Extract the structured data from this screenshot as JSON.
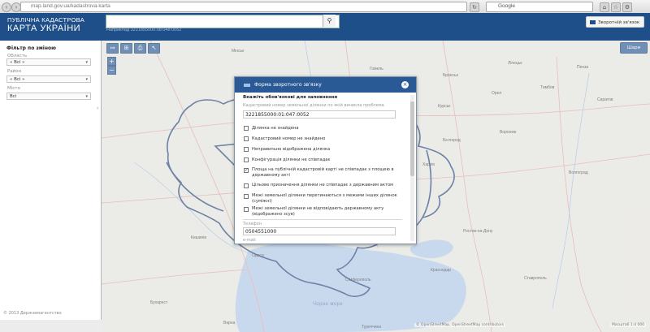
{
  "browser": {
    "url": "map.land.gov.ua/kadastrova-karta",
    "search_text": "Google"
  },
  "header": {
    "brand_line1": "ПУБЛІЧНА КАДАСТРОВА",
    "brand_line2": "КАРТА УКРАЇНИ",
    "search_value": "",
    "search_hint": "Наприклад 3221855000:08:048:0052",
    "feedback_label": "Зворотній зв'язок"
  },
  "sidebar": {
    "title": "Фільтр по зміною",
    "fields": [
      {
        "label": "Область",
        "value": "« Всі »"
      },
      {
        "label": "Район",
        "value": "« Всі »"
      },
      {
        "label": "Місто",
        "value": "Всі"
      }
    ],
    "copyright": "© 2013 Держземагентство"
  },
  "map": {
    "layers_button": "Шари",
    "tools": [
      "ruler-icon",
      "area-icon",
      "print-icon",
      "pointer-icon"
    ],
    "zoom_in": "+",
    "zoom_out": "−",
    "attribution": "© OpenStreetMap, OpenStreetMap contributors",
    "coords": "Масштаб 1:4 000",
    "places": [
      {
        "name": "Мінськ"
      },
      {
        "name": "Гомель"
      },
      {
        "name": "Брянськ"
      },
      {
        "name": "Орел"
      },
      {
        "name": "Курськ"
      },
      {
        "name": "Воронеж"
      },
      {
        "name": "Бєлгород"
      },
      {
        "name": "Харків"
      },
      {
        "name": "Ростов-на-Дону"
      },
      {
        "name": "Краснодар"
      },
      {
        "name": "Ставрополь"
      },
      {
        "name": "Кишинів"
      },
      {
        "name": "Бухарест"
      },
      {
        "name": "Варна"
      },
      {
        "name": "Одеса"
      },
      {
        "name": "Сімферополь"
      },
      {
        "name": "Чорне море"
      },
      {
        "name": "Волгоград"
      },
      {
        "name": "Саратов"
      },
      {
        "name": "Пенза"
      },
      {
        "name": "Тамбов"
      },
      {
        "name": "Ліпецьк"
      },
      {
        "name": "Туреччина"
      }
    ]
  },
  "dialog": {
    "title": "Форма зворотного зв'язку",
    "section_heading": "Вкажіть обов'язкові для заповнення",
    "cadastral_note": "Кадастровий номер земельної ділянки по якій виникла проблема",
    "cadastral_value": "3221855000:01:047:0052",
    "checkboxes": [
      {
        "label": "Ділянка не знайдена",
        "checked": false
      },
      {
        "label": "Кадастровий номер не знайдено",
        "checked": false
      },
      {
        "label": "Неправильно відображена ділянка",
        "checked": false
      },
      {
        "label": "Конфігурація ділянки не співпадає",
        "checked": false
      },
      {
        "label": "Площа на публічній кадастровій карті не співпадає з площею в державному акті",
        "checked": true
      },
      {
        "label": "Цільове призначення ділянки не співпадає з державним актом",
        "checked": false
      },
      {
        "label": "Межі земельної ділянки перетинаються з межами інших ділянок (суміжні)",
        "checked": false
      },
      {
        "label": "Межі земельної ділянки не відповідають державному акту (відображено зсув)",
        "checked": false
      }
    ],
    "phone_label": "Телефон",
    "phone_value": "0504551000",
    "email_label": "e-mail"
  }
}
